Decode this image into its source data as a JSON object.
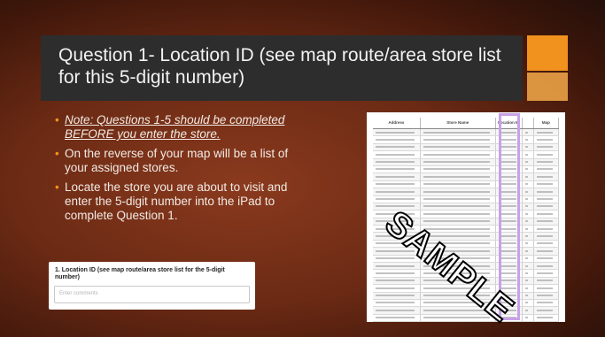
{
  "slide": {
    "title": "Question 1- Location ID (see map route/area store list for this 5-digit number)",
    "bullets": [
      "Note: Questions 1-5 should be completed BEFORE you enter the store.",
      "On the reverse of your map will be a list of your assigned stores.",
      "Locate the store you are about to visit and enter the 5-digit number into the iPad to complete Question 1."
    ],
    "colors": {
      "accent": "#f0921d",
      "title_bar": "#2d2d2d",
      "background": "#6b2a14"
    }
  },
  "form": {
    "label": "1. Location ID (see map route/area store list for the 5-digit number)",
    "placeholder": "Enter comments"
  },
  "store_list": {
    "headers": [
      "Address",
      "Store Name",
      "Location ID",
      "",
      "Map"
    ],
    "watermark": "SAMPLE"
  }
}
